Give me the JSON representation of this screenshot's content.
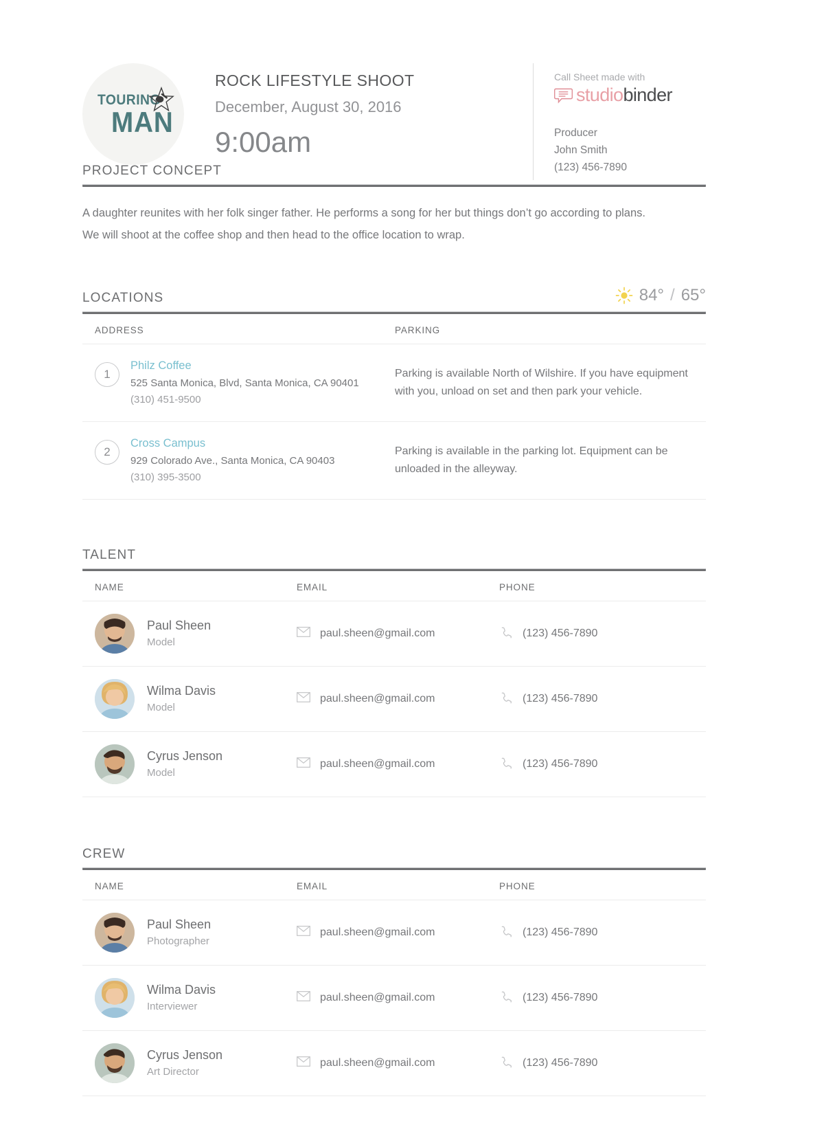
{
  "header": {
    "logo": {
      "line1": "TOURING",
      "line2": "MAN",
      "star_icon": "star-guitar-icon"
    },
    "project_title": "ROCK LIFESTYLE SHOOT",
    "project_date": "December, August 30, 2016",
    "call_time": "9:00am",
    "made_with_label": "Call Sheet made with",
    "brand": {
      "name_part1": "studio",
      "name_part2": "binder",
      "mark_icon": "speech-bubble-icon",
      "color_part1": "#e8a0a6",
      "color_part2": "#4b4c4e"
    },
    "producer": {
      "role_label": "Producer",
      "name": "John Smith",
      "phone": "(123) 456-7890"
    }
  },
  "concept": {
    "section_title": "PROJECT CONCEPT",
    "lines": [
      "A daughter reunites with her folk singer father. He performs a song for her but things don’t go according to plans.",
      "We will shoot at the coffee shop and then head to the office location to wrap."
    ]
  },
  "locations": {
    "section_title": "LOCATIONS",
    "weather": {
      "icon": "sun-icon",
      "high": "84°",
      "separator": "/",
      "low": "65°",
      "icon_color": "#f2d34e"
    },
    "columns": [
      "ADDRESS",
      "PARKING"
    ],
    "rows": [
      {
        "number": "1",
        "name": "Philz Coffee",
        "address": "525 Santa Monica, Blvd, Santa Monica, CA 90401",
        "phone": "(310) 451-9500",
        "parking": "Parking is available North of Wilshire.  If you have equipment with you, unload on set and then park your vehicle."
      },
      {
        "number": "2",
        "name": "Cross Campus",
        "address": "929 Colorado Ave., Santa Monica, CA 90403",
        "phone": "(310) 395-3500",
        "parking": "Parking is available in the parking lot. Equipment can be unloaded in the alleyway."
      }
    ],
    "name_color": "#79bfcf"
  },
  "talent": {
    "section_title": "TALENT",
    "columns": [
      "NAME",
      "EMAIL",
      "PHONE"
    ],
    "rows": [
      {
        "name": "Paul Sheen",
        "role": "Model",
        "email": "paul.sheen@gmail.com",
        "phone": "(123) 456-7890",
        "avatar": "avatar-male-dark-hair"
      },
      {
        "name": "Wilma Davis",
        "role": "Model",
        "email": "paul.sheen@gmail.com",
        "phone": "(123) 456-7890",
        "avatar": "avatar-female-blonde"
      },
      {
        "name": "Cyrus Jenson",
        "role": "Model",
        "email": "paul.sheen@gmail.com",
        "phone": "(123) 456-7890",
        "avatar": "avatar-male-beard"
      }
    ]
  },
  "crew": {
    "section_title": "CREW",
    "columns": [
      "NAME",
      "EMAIL",
      "PHONE"
    ],
    "rows": [
      {
        "name": "Paul Sheen",
        "role": "Photographer",
        "email": "paul.sheen@gmail.com",
        "phone": "(123) 456-7890",
        "avatar": "avatar-male-dark-hair"
      },
      {
        "name": "Wilma Davis",
        "role": "Interviewer",
        "email": "paul.sheen@gmail.com",
        "phone": "(123) 456-7890",
        "avatar": "avatar-female-blonde"
      },
      {
        "name": "Cyrus Jenson",
        "role": "Art Director",
        "email": "paul.sheen@gmail.com",
        "phone": "(123) 456-7890",
        "avatar": "avatar-male-beard"
      }
    ]
  },
  "icons": {
    "email": "envelope-icon",
    "phone": "phone-handset-icon"
  }
}
